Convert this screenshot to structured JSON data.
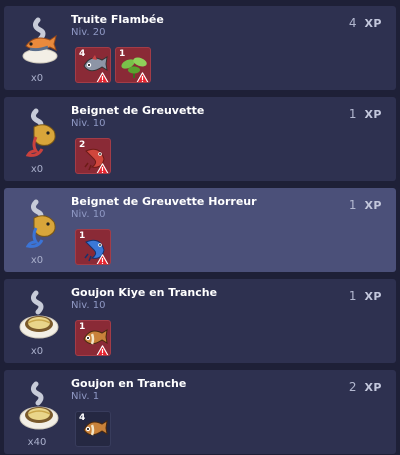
{
  "xp_label": "XP",
  "recipes": [
    {
      "name": "Truite Flambée",
      "level": "Niv. 20",
      "quantity": "x0",
      "xp": "4",
      "selected": false,
      "icon": "grilled-fish-icon",
      "ingredients": [
        {
          "count": "4",
          "icon": "grey-fish-icon",
          "missing": true
        },
        {
          "count": "1",
          "icon": "green-herb-icon",
          "missing": true
        }
      ]
    },
    {
      "name": "Beignet de Greuvette",
      "level": "Niv. 10",
      "quantity": "x0",
      "xp": "1",
      "selected": false,
      "icon": "shrimp-fritter-icon",
      "ingredients": [
        {
          "count": "2",
          "icon": "red-shrimp-icon",
          "missing": true
        }
      ]
    },
    {
      "name": "Beignet de Greuvette Horreur",
      "level": "Niv. 10",
      "quantity": "x0",
      "xp": "1",
      "selected": true,
      "icon": "blue-shrimp-fritter-icon",
      "ingredients": [
        {
          "count": "1",
          "icon": "blue-shrimp-icon",
          "missing": true
        }
      ]
    },
    {
      "name": "Goujon Kiye en Tranche",
      "level": "Niv. 10",
      "quantity": "x0",
      "xp": "1",
      "selected": false,
      "icon": "fish-slice-icon",
      "ingredients": [
        {
          "count": "1",
          "icon": "brown-fish-icon",
          "missing": true
        }
      ]
    },
    {
      "name": "Goujon en Tranche",
      "level": "Niv. 1",
      "quantity": "x40",
      "xp": "2",
      "selected": false,
      "icon": "fish-slice-icon",
      "ingredients": [
        {
          "count": "4",
          "icon": "brown-fish-icon",
          "missing": false
        }
      ]
    }
  ]
}
